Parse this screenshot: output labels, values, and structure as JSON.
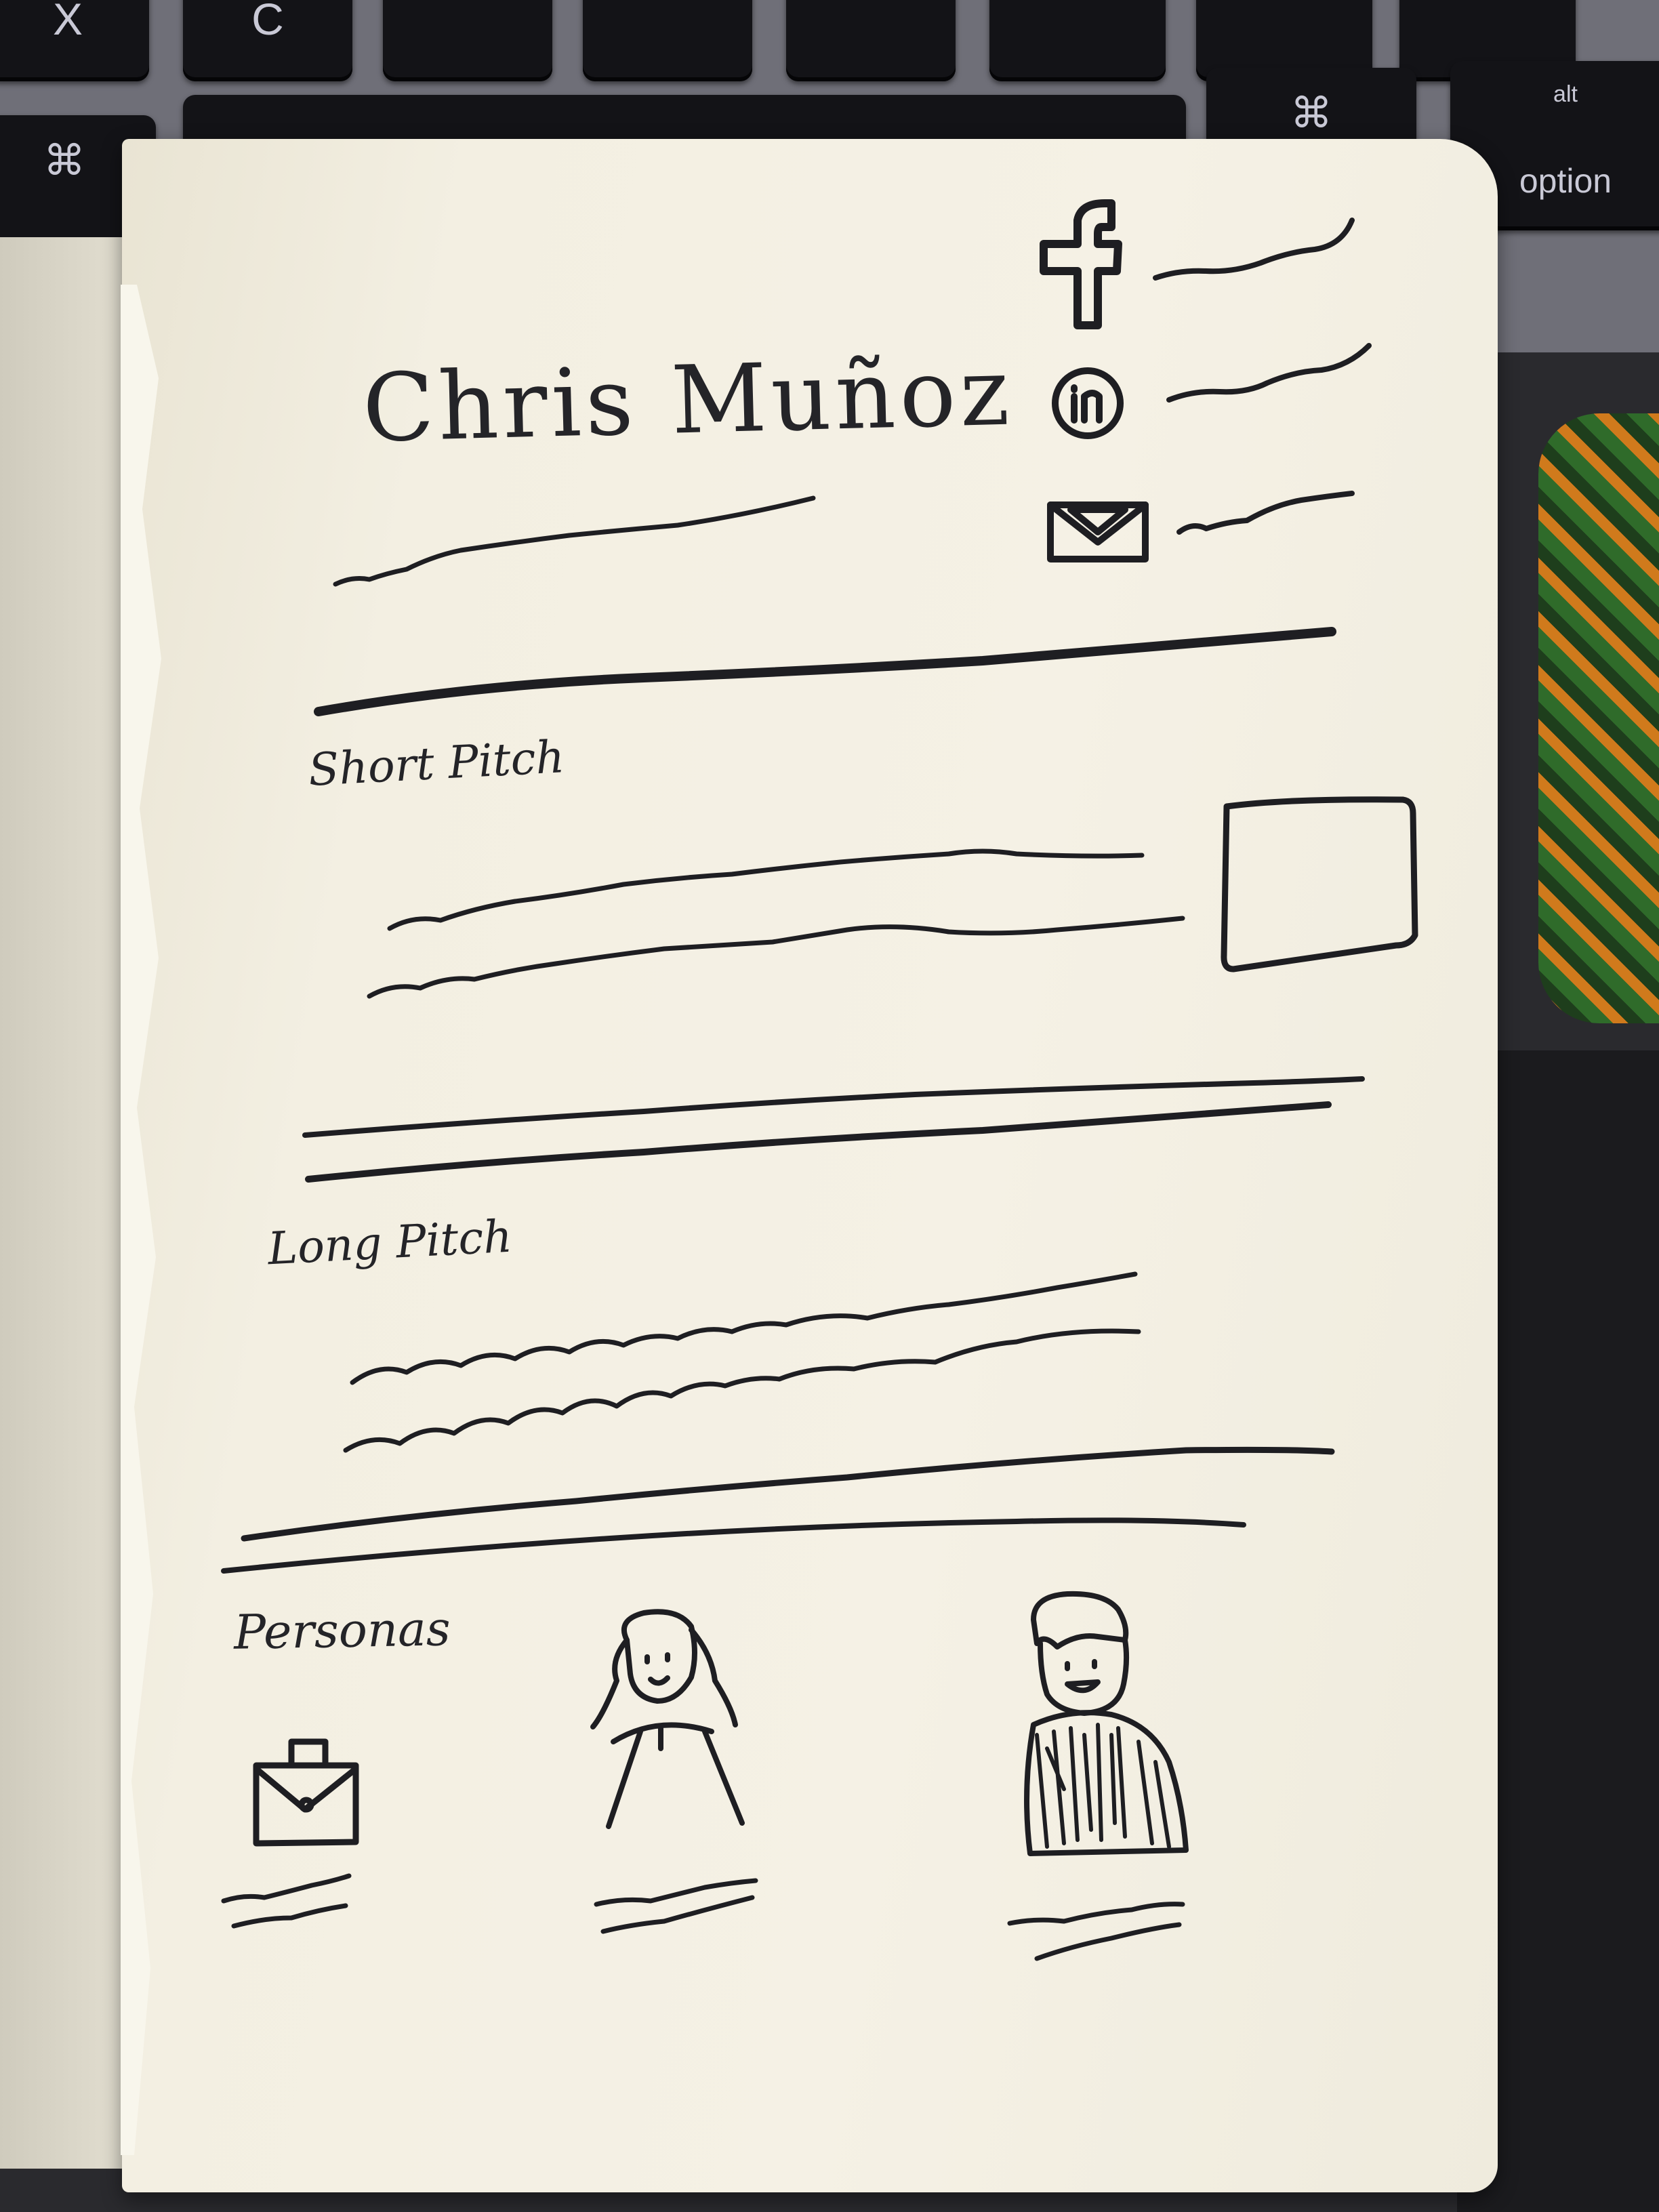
{
  "keyboard": {
    "keys": {
      "x": "X",
      "c": "C",
      "cmd_left": "⌘",
      "cmd_right": "⌘",
      "alt": "alt",
      "option": "option"
    }
  },
  "sketch": {
    "name": "Chris Muñoz",
    "social_icons": [
      "facebook-icon",
      "linkedin-icon",
      "email-icon"
    ],
    "sections": {
      "short_pitch": "Short Pitch",
      "long_pitch": "Long Pitch",
      "personas": "Personas"
    },
    "persona_icons": [
      "briefcase-icon",
      "woman-persona-icon",
      "man-persona-icon"
    ]
  },
  "colors": {
    "paper": "#f3efe2",
    "ink": "#1e1e22",
    "keyboard": "#131317"
  }
}
